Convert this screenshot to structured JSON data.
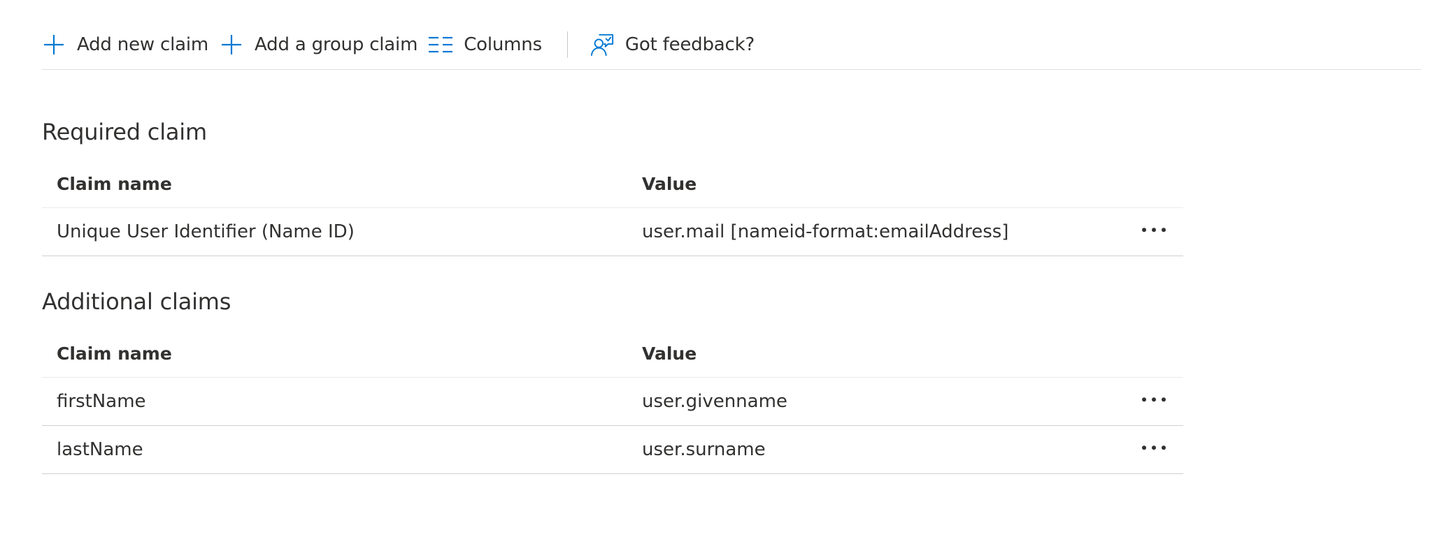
{
  "toolbar": {
    "add_new_claim": "Add new claim",
    "add_group_claim": "Add a group claim",
    "columns": "Columns",
    "feedback": "Got feedback?"
  },
  "required": {
    "title": "Required claim",
    "headers": {
      "name": "Claim name",
      "value": "Value"
    },
    "rows": [
      {
        "name": "Unique User Identifier (Name ID)",
        "value": "user.mail [nameid-format:emailAddress]"
      }
    ]
  },
  "additional": {
    "title": "Additional claims",
    "headers": {
      "name": "Claim name",
      "value": "Value"
    },
    "rows": [
      {
        "name": "firstName",
        "value": "user.givenname"
      },
      {
        "name": "lastName",
        "value": "user.surname"
      }
    ]
  },
  "icons": {
    "add": "plus-icon",
    "group": "plus-icon",
    "columns": "columns-icon",
    "feedback": "feedback-icon",
    "more": "more-icon"
  },
  "colors": {
    "accent": "#0078d4",
    "text": "#323130",
    "divider": "#e1dfdd"
  }
}
